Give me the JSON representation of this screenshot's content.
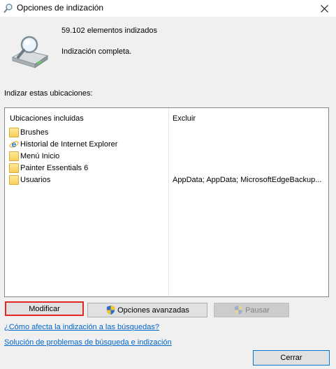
{
  "window": {
    "title": "Opciones de indización",
    "icon": "indexing-options-icon",
    "close_icon": "close-icon"
  },
  "summary": {
    "count_text": "59.102 elementos indizados",
    "status_text": "Indización completa."
  },
  "locations": {
    "label": "Indizar estas ubicaciones:",
    "columns": {
      "included": "Ubicaciones incluidas",
      "exclude": "Excluir"
    },
    "rows": [
      {
        "icon": "folder-icon",
        "label": "Brushes",
        "exclude": ""
      },
      {
        "icon": "internet-explorer-icon",
        "label": "Historial de Internet Explorer",
        "exclude": ""
      },
      {
        "icon": "folder-icon",
        "label": "Menú Inicio",
        "exclude": ""
      },
      {
        "icon": "folder-icon",
        "label": "Painter Essentials 6",
        "exclude": ""
      },
      {
        "icon": "folder-icon",
        "label": "Usuarios",
        "exclude": "AppData; AppData; MicrosoftEdgeBackup..."
      }
    ]
  },
  "buttons": {
    "modify": "Modificar",
    "advanced": "Opciones avanzadas",
    "pause": "Pausar",
    "close": "Cerrar"
  },
  "links": {
    "howto": "¿Cómo afecta la indización a las búsquedas?",
    "troubleshoot": "Solución de problemas de búsqueda e indización"
  },
  "colors": {
    "highlight_border": "#e32626",
    "link": "#0066cc",
    "default_button_border": "#0078d7"
  }
}
